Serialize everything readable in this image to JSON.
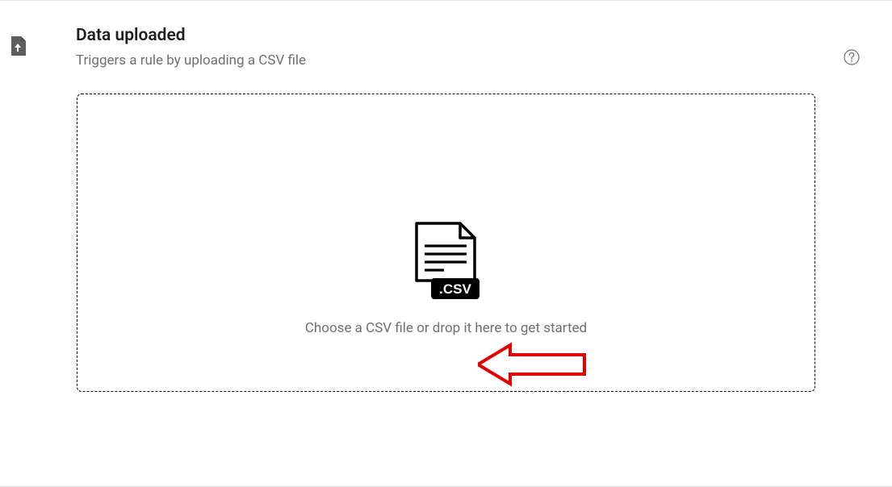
{
  "header": {
    "title": "Data uploaded",
    "subtitle": "Triggers a rule by uploading a CSV file"
  },
  "drop_area": {
    "instruction": "Choose a CSV file or drop it here to get started",
    "csv_label": ".CSV"
  },
  "annotation": {
    "arrow_color": "#e30000"
  }
}
